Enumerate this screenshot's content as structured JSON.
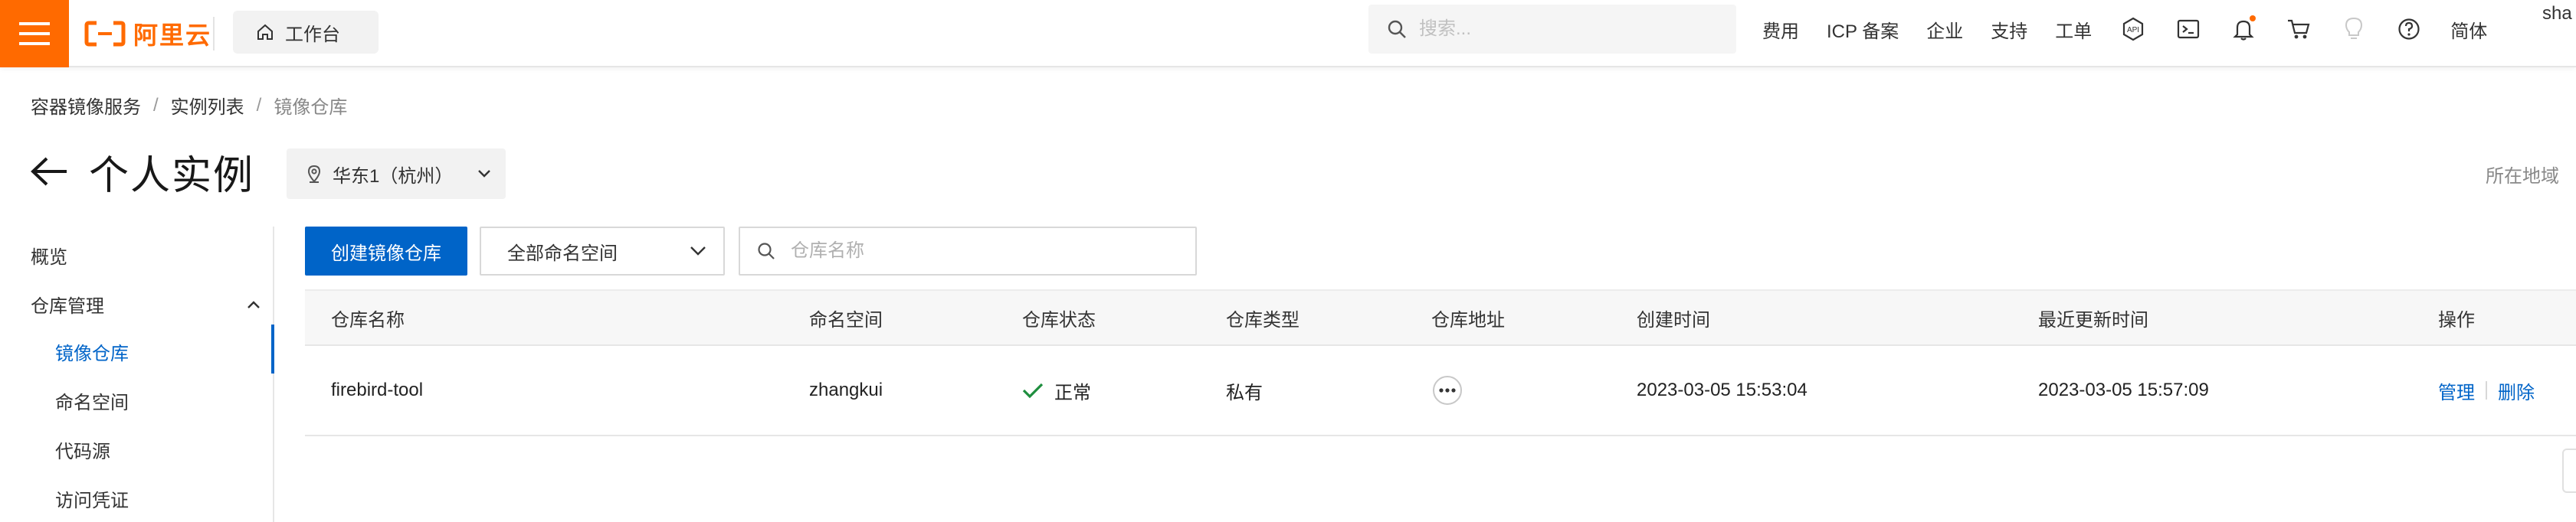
{
  "topbar": {
    "logo_text": "阿里云",
    "workbench_label": "工作台",
    "search_placeholder": "搜索...",
    "nav_links": [
      "费用",
      "ICP 备案",
      "企业",
      "支持",
      "工单"
    ],
    "language": "简体",
    "user_partial": "sha",
    "accent_color": "#ff6a00",
    "icons": [
      "menu-icon",
      "home-icon",
      "search-icon",
      "api-icon",
      "terminal-icon",
      "bell-icon",
      "cart-icon",
      "lightbulb-icon",
      "help-icon"
    ]
  },
  "breadcrumb": [
    "容器镜像服务",
    "实例列表",
    "镜像仓库"
  ],
  "page": {
    "title": "个人实例",
    "region": "华东1（杭州）",
    "region_right_label": "所在地域"
  },
  "sidebar": {
    "overview": "概览",
    "group_label": "仓库管理",
    "items": [
      "镜像仓库",
      "命名空间",
      "代码源",
      "访问凭证"
    ],
    "active_color": "#0064c8"
  },
  "toolbar": {
    "create_button": "创建镜像仓库",
    "namespace_select": "全部命名空间",
    "repo_search_placeholder": "仓库名称"
  },
  "table": {
    "columns": [
      "仓库名称",
      "命名空间",
      "仓库状态",
      "仓库类型",
      "仓库地址",
      "创建时间",
      "最近更新时间",
      "操作"
    ],
    "rows": [
      {
        "name": "firebird-tool",
        "namespace": "zhangkui",
        "status": "正常",
        "type": "私有",
        "created": "2023-03-05 15:53:04",
        "updated": "2023-03-05 15:57:09",
        "actions": [
          "管理",
          "删除"
        ]
      }
    ]
  }
}
